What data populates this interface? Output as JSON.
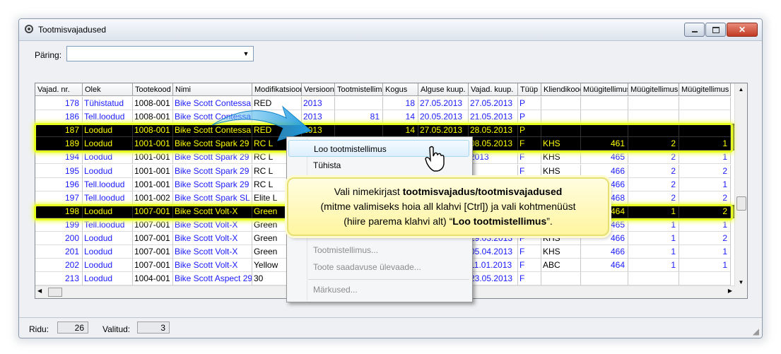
{
  "window": {
    "title": "Tootmisvajadused"
  },
  "query": {
    "label": "Päring:",
    "value": ""
  },
  "columns": [
    "Vajad. nr.",
    "Olek",
    "Tootekood",
    "Nimi",
    "Modifikatsioon",
    "Versioon",
    "Tootmistellimus",
    "Kogus",
    "Alguse kuup.",
    "Vajad. kuup.",
    "Tüüp",
    "Kliendikood",
    "Müügitellimus",
    "Müügitellimus",
    "Müügitellimus"
  ],
  "rows": [
    {
      "nr": "178",
      "olek": "Tühistatud",
      "kood": "1008-001",
      "nimi": "Bike Scott Contessa",
      "mod": "RED",
      "ver": "2013",
      "tt": "",
      "kogus": "18",
      "algus": "27.05.2013",
      "vajad": "27.05.2013",
      "tyyp": "P",
      "klient": "",
      "m1": "",
      "m2": "",
      "m3": ""
    },
    {
      "nr": "186",
      "olek": "Tell.loodud",
      "kood": "1008-001",
      "nimi": "Bike Scott Contessa",
      "mod": "",
      "ver": "2013",
      "tt": "81",
      "kogus": "14",
      "algus": "20.05.2013",
      "vajad": "21.05.2013",
      "tyyp": "P",
      "klient": "",
      "m1": "",
      "m2": "",
      "m3": ""
    },
    {
      "nr": "187",
      "olek": "Loodud",
      "kood": "1008-001",
      "nimi": "Bike Scott Contessa",
      "mod": "RED",
      "ver": "2013",
      "tt": "",
      "kogus": "14",
      "algus": "27.05.2013",
      "vajad": "28.05.2013",
      "tyyp": "P",
      "klient": "",
      "m1": "",
      "m2": "",
      "m3": ""
    },
    {
      "nr": "189",
      "olek": "Loodud",
      "kood": "1001-001",
      "nimi": "Bike Scott Spark 29",
      "mod": "RC L",
      "ver": "",
      "tt": "",
      "kogus": "",
      "algus": "",
      "vajad": "08.05.2013",
      "tyyp": "F",
      "klient": "KHS",
      "m1": "461",
      "m2": "2",
      "m3": "1"
    },
    {
      "nr": "194",
      "olek": "Loodud",
      "kood": "1001-001",
      "nimi": "Bike Scott Spark 29",
      "mod": "RC L",
      "ver": "",
      "tt": "",
      "kogus": "",
      "algus": "",
      "vajad": "2013",
      "tyyp": "F",
      "klient": "KHS",
      "m1": "465",
      "m2": "2",
      "m3": "1"
    },
    {
      "nr": "195",
      "olek": "Loodud",
      "kood": "1001-001",
      "nimi": "Bike Scott Spark 29",
      "mod": "RC L",
      "ver": "",
      "tt": "",
      "kogus": "",
      "algus": "",
      "vajad": "",
      "tyyp": "F",
      "klient": "KHS",
      "m1": "466",
      "m2": "2",
      "m3": "2"
    },
    {
      "nr": "196",
      "olek": "Tell.loodud",
      "kood": "1001-001",
      "nimi": "Bike Scott Spark 29",
      "mod": "RC L",
      "ver": "",
      "tt": "",
      "kogus": "",
      "algus": "",
      "vajad": "",
      "tyyp": "",
      "klient": "",
      "m1": "466",
      "m2": "2",
      "m3": "1"
    },
    {
      "nr": "197",
      "olek": "Tell.loodud",
      "kood": "1001-002",
      "nimi": "Bike Scott Spark SL",
      "mod": "Elite L",
      "ver": "",
      "tt": "",
      "kogus": "",
      "algus": "",
      "vajad": "",
      "tyyp": "",
      "klient": "",
      "m1": "468",
      "m2": "2",
      "m3": "2"
    },
    {
      "nr": "198",
      "olek": "Loodud",
      "kood": "1007-001",
      "nimi": "Bike Scott Volt-X",
      "mod": "Green",
      "ver": "",
      "tt": "",
      "kogus": "",
      "algus": "",
      "vajad": "",
      "tyyp": "",
      "klient": "",
      "m1": "464",
      "m2": "1",
      "m3": "2"
    },
    {
      "nr": "199",
      "olek": "Tell.loodud",
      "kood": "1007-001",
      "nimi": "Bike Scott Volt-X",
      "mod": "Green",
      "ver": "",
      "tt": "",
      "kogus": "",
      "algus": "",
      "vajad": "",
      "tyyp": "",
      "klient": "",
      "m1": "465",
      "m2": "1",
      "m3": "1"
    },
    {
      "nr": "200",
      "olek": "Loodud",
      "kood": "1007-001",
      "nimi": "Bike Scott Volt-X",
      "mod": "Green",
      "ver": "",
      "tt": "",
      "kogus": "",
      "algus": "",
      "vajad": "29.03.2013",
      "tyyp": "F",
      "klient": "KHS",
      "m1": "466",
      "m2": "1",
      "m3": "2"
    },
    {
      "nr": "201",
      "olek": "Loodud",
      "kood": "1007-001",
      "nimi": "Bike Scott Volt-X",
      "mod": "Green",
      "ver": "",
      "tt": "",
      "kogus": "",
      "algus": "",
      "vajad": "05.04.2013",
      "tyyp": "F",
      "klient": "KHS",
      "m1": "466",
      "m2": "1",
      "m3": "1"
    },
    {
      "nr": "202",
      "olek": "Loodud",
      "kood": "1007-001",
      "nimi": "Bike Scott Volt-X",
      "mod": "Yellow",
      "ver": "",
      "tt": "",
      "kogus": "",
      "algus": "",
      "vajad": "11.01.2013",
      "tyyp": "F",
      "klient": "ABC",
      "m1": "464",
      "m2": "1",
      "m3": "1"
    },
    {
      "nr": "213",
      "olek": "Loodud",
      "kood": "1004-001",
      "nimi": "Bike Scott Aspect 29",
      "mod": "30",
      "ver": "",
      "tt": "",
      "kogus": "",
      "algus": "",
      "vajad": "23.05.2013",
      "tyyp": "F",
      "klient": "",
      "m1": "",
      "m2": "",
      "m3": ""
    }
  ],
  "selected_rows": [
    2,
    3,
    8
  ],
  "context_menu": {
    "items": [
      "Loo tootmistellimus",
      "Tühista",
      "Tootmistellimus...",
      "Toote saadavuse ülevaade...",
      "Märkused..."
    ]
  },
  "callout": {
    "t1": "Vali nimekirjast ",
    "t1b": "tootmisvajadus/tootmisvajadused",
    "t2": "(mitme valimiseks hoia all klahvi [Ctrl]) ja vali kohtmenüüst",
    "t3": "(hiire parema klahvi alt) “",
    "t3b": "Loo tootmistellimus",
    "t3c": "”."
  },
  "status": {
    "rows_label": "Ridu:",
    "rows_value": "26",
    "selected_label": "Valitud:",
    "selected_value": "3"
  },
  "colors": {
    "selection_bg": "#000000",
    "selection_text": "#ffff00",
    "highlight_glow": "#e6ff20",
    "link_blue": "#1a1aff"
  }
}
